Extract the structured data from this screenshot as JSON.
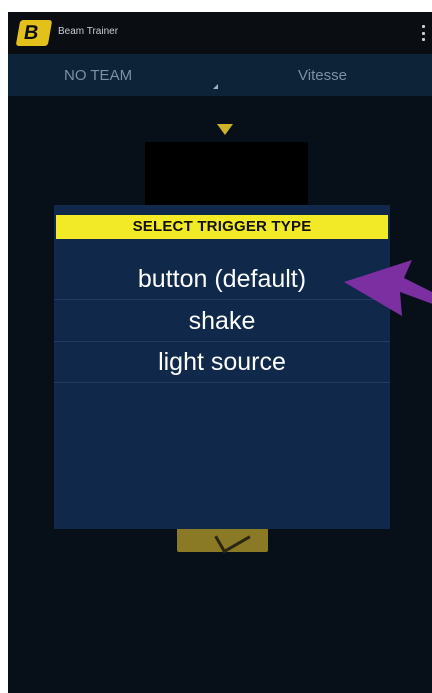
{
  "app": {
    "title": "Beam Trainer",
    "brand_color": "#e4c11a"
  },
  "tabs": [
    {
      "label": "NO TEAM"
    },
    {
      "label": "Vitesse"
    }
  ],
  "dialog": {
    "title": "SELECT TRIGGER TYPE",
    "title_bg": "#f2ea26",
    "options": [
      {
        "label": "button (default)"
      },
      {
        "label": "shake"
      },
      {
        "label": "light source"
      }
    ]
  },
  "annotation": {
    "arrow_color": "#7b2fa1"
  }
}
